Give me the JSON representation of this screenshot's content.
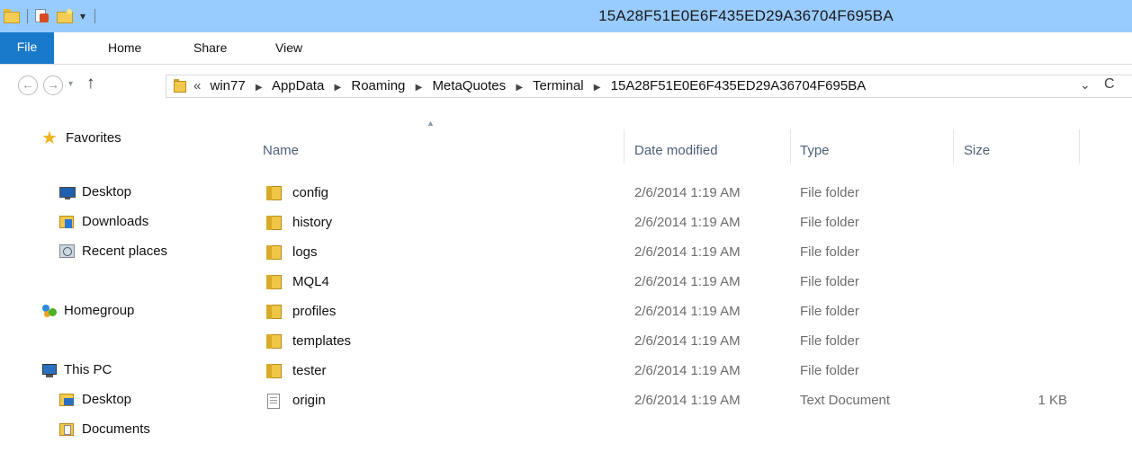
{
  "window": {
    "title": "15A28F51E0E6F435ED29A36704F695BA",
    "qat_dropdown": "▾"
  },
  "ribbon": {
    "tabs": [
      "File",
      "Home",
      "Share",
      "View"
    ]
  },
  "nav": {
    "back": "←",
    "forward": "→",
    "recent_dropdown": "▾",
    "up": "↑"
  },
  "address": {
    "overflow": "«",
    "crumbs": [
      "win77",
      "AppData",
      "Roaming",
      "MetaQuotes",
      "Terminal",
      "15A28F51E0E6F435ED29A36704F695BA"
    ],
    "separator": "▶",
    "dropdown": "⌄",
    "refresh": "C"
  },
  "nav_pane": {
    "favorites": {
      "label": "Favorites",
      "items": [
        "Desktop",
        "Downloads",
        "Recent places"
      ]
    },
    "homegroup": "Homegroup",
    "this_pc": {
      "label": "This PC",
      "items": [
        "Desktop",
        "Documents"
      ]
    }
  },
  "file_list": {
    "columns": {
      "name": "Name",
      "date": "Date modified",
      "type": "Type",
      "size": "Size"
    },
    "sort_indicator": "▲",
    "rows": [
      {
        "name": "config",
        "date": "2/6/2014 1:19 AM",
        "type": "File folder",
        "size": "",
        "icon": "folder-icon"
      },
      {
        "name": "history",
        "date": "2/6/2014 1:19 AM",
        "type": "File folder",
        "size": "",
        "icon": "folder-icon"
      },
      {
        "name": "logs",
        "date": "2/6/2014 1:19 AM",
        "type": "File folder",
        "size": "",
        "icon": "folder-icon"
      },
      {
        "name": "MQL4",
        "date": "2/6/2014 1:19 AM",
        "type": "File folder",
        "size": "",
        "icon": "folder-icon"
      },
      {
        "name": "profiles",
        "date": "2/6/2014 1:19 AM",
        "type": "File folder",
        "size": "",
        "icon": "folder-icon"
      },
      {
        "name": "templates",
        "date": "2/6/2014 1:19 AM",
        "type": "File folder",
        "size": "",
        "icon": "folder-icon"
      },
      {
        "name": "tester",
        "date": "2/6/2014 1:19 AM",
        "type": "File folder",
        "size": "",
        "icon": "folder-icon"
      },
      {
        "name": "origin",
        "date": "2/6/2014 1:19 AM",
        "type": "Text Document",
        "size": "1 KB",
        "icon": "text-document-icon"
      }
    ]
  },
  "colors": {
    "title_bar": "#99ccfe",
    "file_tab": "#1979ca",
    "column_header_text": "#4c607a",
    "secondary_text": "#6d6d6d",
    "folder": "#f0c646"
  }
}
